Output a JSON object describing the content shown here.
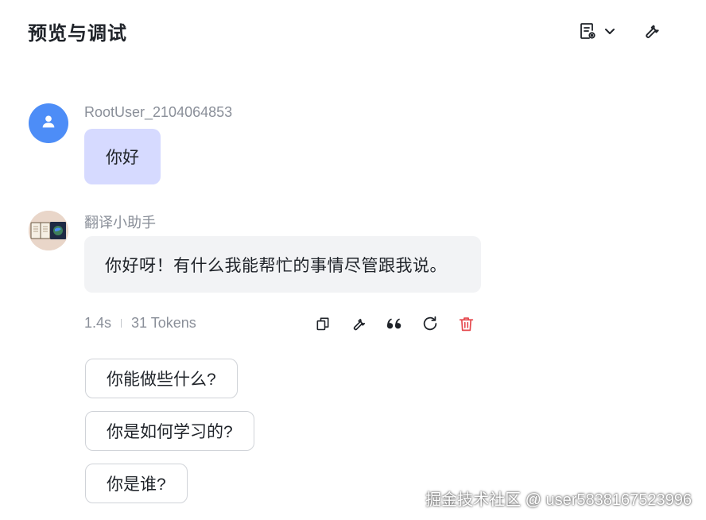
{
  "header": {
    "title": "预览与调试",
    "history_icon": "document-settings-icon",
    "dropdown_icon": "chevron-down-icon",
    "settings_icon": "wrench-icon"
  },
  "messages": {
    "user": {
      "name": "RootUser_2104064853",
      "text": "你好",
      "avatar_icon": "user-icon"
    },
    "bot": {
      "name": "翻译小助手",
      "text": "你好呀！有什么我能帮忙的事情尽管跟我说。"
    }
  },
  "meta": {
    "duration": "1.4s",
    "tokens": "31 Tokens"
  },
  "actions": {
    "copy": "copy-icon",
    "debug": "wrench-icon",
    "quote": "quote-icon",
    "regenerate": "refresh-icon",
    "delete": "trash-icon"
  },
  "suggestions": [
    "你能做些什么?",
    "你是如何学习的?",
    "你是谁?"
  ],
  "watermark": "掘金技术社区 @ user5838167523996",
  "colors": {
    "accent": "#4d8df7",
    "user_bubble": "#d6daff",
    "bot_bubble": "#f2f3f5",
    "danger": "#e5484d"
  }
}
